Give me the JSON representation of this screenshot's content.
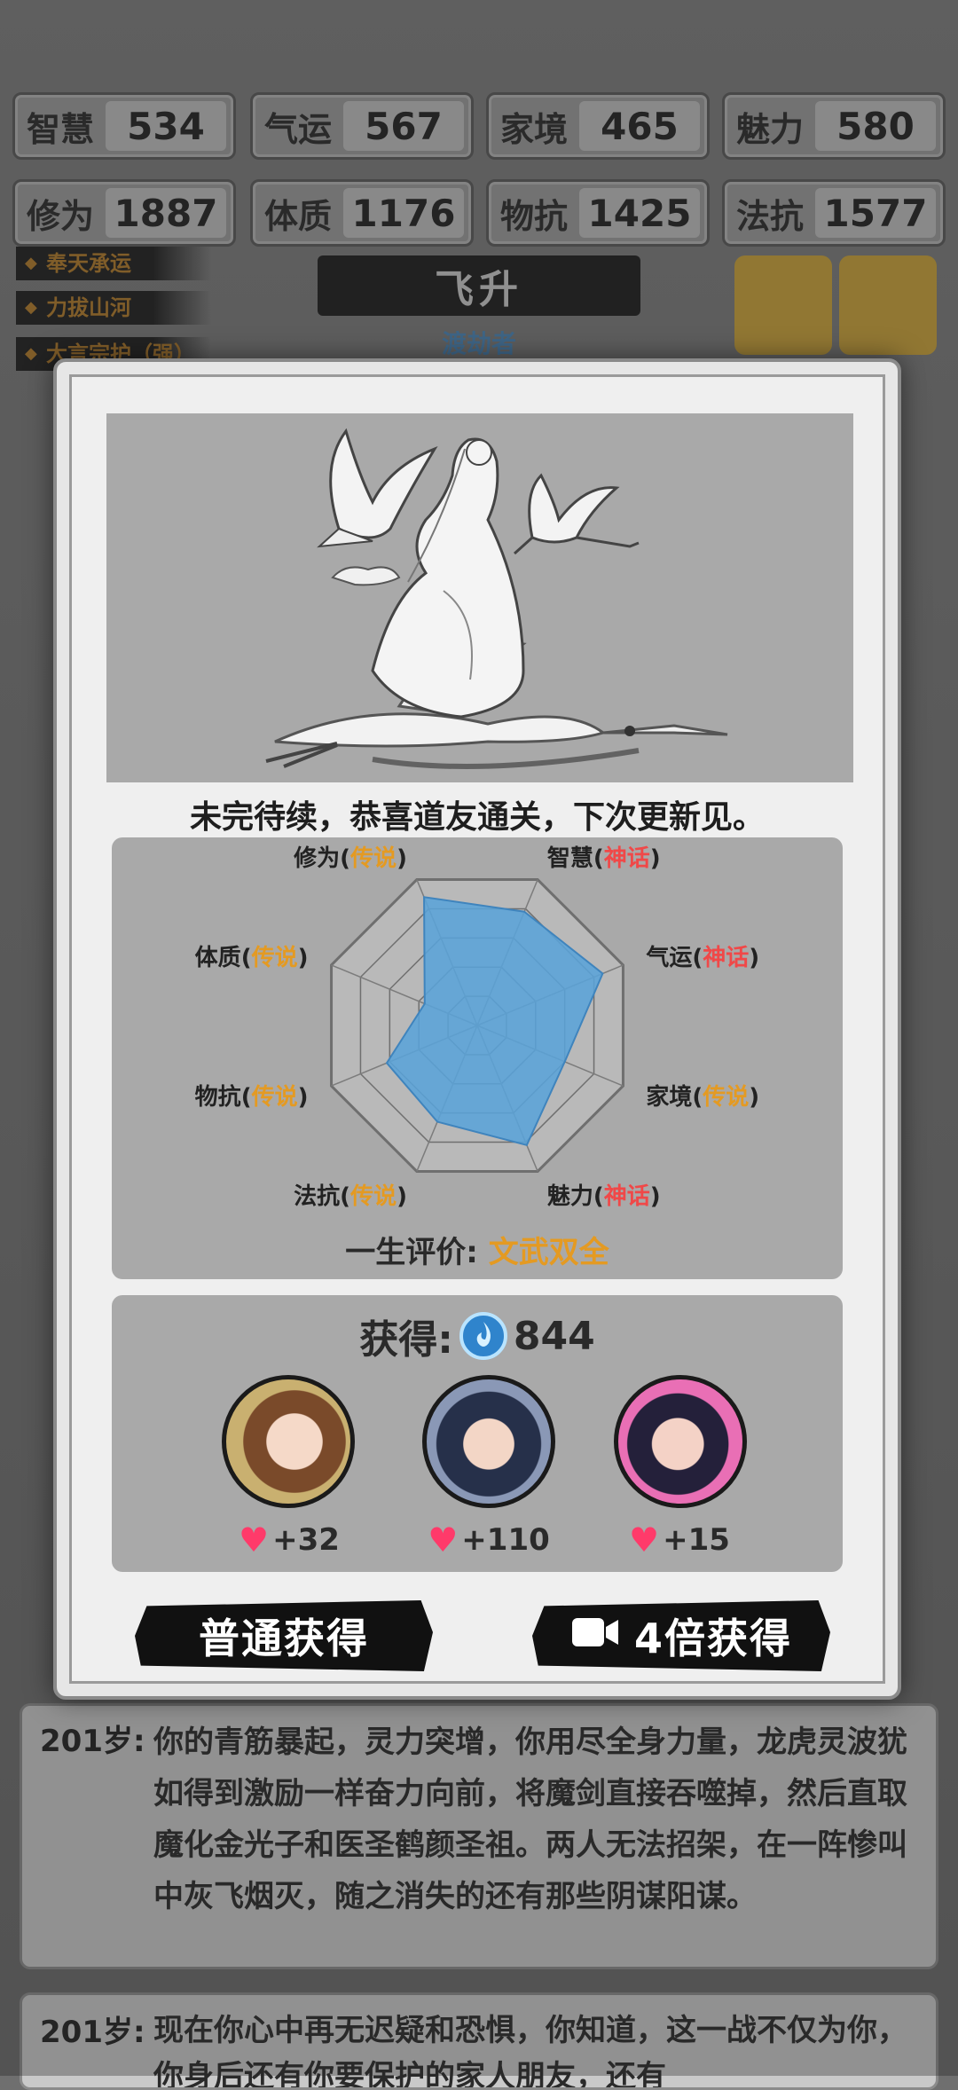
{
  "stats": [
    {
      "label": "智慧",
      "value": "534"
    },
    {
      "label": "气运",
      "value": "567"
    },
    {
      "label": "家境",
      "value": "465"
    },
    {
      "label": "魅力",
      "value": "580"
    },
    {
      "label": "修为",
      "value": "1887"
    },
    {
      "label": "体质",
      "value": "1176"
    },
    {
      "label": "物抗",
      "value": "1425"
    },
    {
      "label": "法抗",
      "value": "1577"
    }
  ],
  "background": {
    "skills": [
      "奉天承运",
      "力拔山河",
      "大言宗护（强）"
    ],
    "realm_title": "飞升",
    "realm_subtitle": "渡劫者"
  },
  "log": [
    {
      "age": "201岁:",
      "text": "你的青筋暴起，灵力突增，你用尽全身力量，龙虎灵波犹如得到激励一样奋力向前，将魔剑直接吞噬掉，然后直取魔化金光子和医圣鹤颜圣祖。两人无法招架，在一阵惨叫中灰飞烟灭，随之消失的还有那些阴谋阳谋。"
    },
    {
      "age": "201岁:",
      "text": "现在你心中再无迟疑和恐惧，你知道，这一战不仅为你，你身后还有你要保护的家人朋友，还有"
    }
  ],
  "modal": {
    "ending_text": "未完待续，恭喜道友通关，下次更新见。",
    "radar": {
      "axes": [
        {
          "name": "智慧",
          "grade": "神话",
          "grade_color": "#f04848",
          "level": 0.78
        },
        {
          "name": "气运",
          "grade": "神话",
          "grade_color": "#f04848",
          "level": 0.86
        },
        {
          "name": "家境",
          "grade": "传说",
          "grade_color": "#e49a22",
          "level": 0.6
        },
        {
          "name": "魅力",
          "grade": "神话",
          "grade_color": "#f04848",
          "level": 0.82
        },
        {
          "name": "法抗",
          "grade": "传说",
          "grade_color": "#e49a22",
          "level": 0.66
        },
        {
          "name": "物抗",
          "grade": "传说",
          "grade_color": "#e49a22",
          "level": 0.62
        },
        {
          "name": "体质",
          "grade": "传说",
          "grade_color": "#e49a22",
          "level": 0.36
        },
        {
          "name": "修为",
          "grade": "传说",
          "grade_color": "#e49a22",
          "level": 0.88
        }
      ],
      "paren_open": "(",
      "paren_close": ")"
    },
    "evaluation_label": "一生评价:",
    "evaluation_value": "文武双全",
    "reward_label": "获得:",
    "reward_amount": "844",
    "companions": [
      {
        "gain": "+32"
      },
      {
        "gain": "+110"
      },
      {
        "gain": "+15"
      }
    ],
    "btn_normal": "普通获得",
    "btn_video": "4倍获得"
  },
  "colors": {
    "radar_fill": "#5aa3d8",
    "gold": "#e49a22",
    "red": "#f04848"
  }
}
